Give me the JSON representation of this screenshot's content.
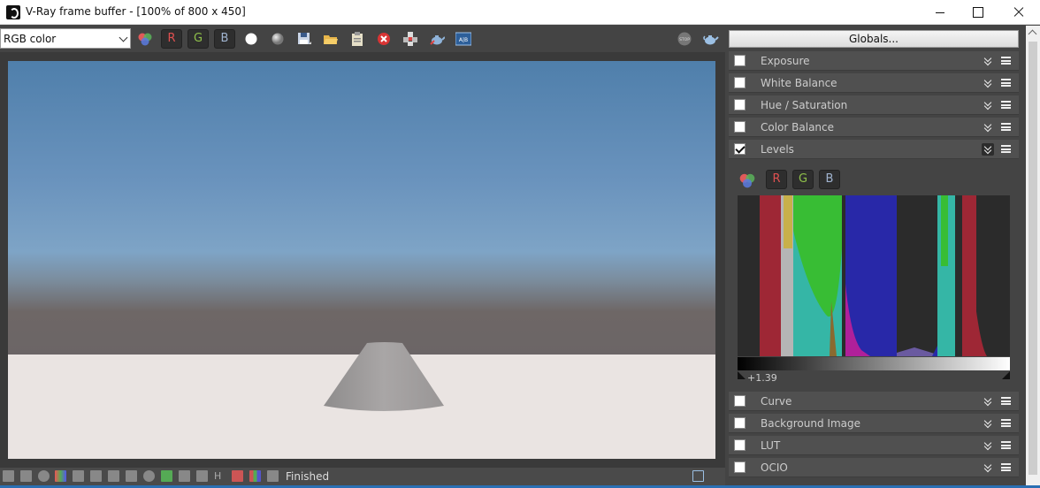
{
  "window": {
    "title": "V-Ray frame buffer - [100% of 800 x 450]"
  },
  "toolbar": {
    "channel": "RGB color",
    "r_label": "R",
    "g_label": "G",
    "b_label": "B"
  },
  "panel": {
    "globals_label": "Globals...",
    "rollouts": [
      {
        "label": "Exposure",
        "checked": false
      },
      {
        "label": "White Balance",
        "checked": false
      },
      {
        "label": "Hue / Saturation",
        "checked": false
      },
      {
        "label": "Color Balance",
        "checked": false
      },
      {
        "label": "Levels",
        "checked": true
      },
      {
        "label": "Curve",
        "checked": false
      },
      {
        "label": "Background Image",
        "checked": false
      },
      {
        "label": "LUT",
        "checked": false
      },
      {
        "label": "OCIO",
        "checked": false
      }
    ],
    "levels": {
      "r_label": "R",
      "g_label": "G",
      "b_label": "B",
      "value": "+1.39"
    }
  },
  "status": {
    "text": "Finished"
  },
  "colors": {
    "accent_blue": "#2a6fb3",
    "red": "#e05050",
    "green": "#8fc04a",
    "blue_text": "#a0b4d0"
  }
}
